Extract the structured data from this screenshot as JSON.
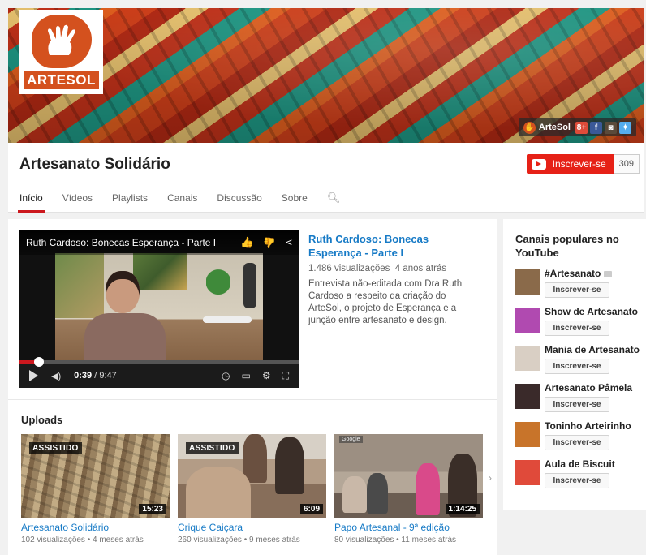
{
  "banner": {
    "logo_text": "ARTESOL",
    "link_name": "ArteSol",
    "social": [
      {
        "icon": "google-plus-icon",
        "glyph": "8+",
        "color": "#dd4b39"
      },
      {
        "icon": "facebook-icon",
        "glyph": "f",
        "color": "#3b5998"
      },
      {
        "icon": "instagram-icon",
        "glyph": "◙",
        "color": "#5a4a3a"
      },
      {
        "icon": "twitter-icon",
        "glyph": "✦",
        "color": "#55acee"
      }
    ]
  },
  "channel": {
    "title": "Artesanato Solidário",
    "subscribe_label": "Inscrever-se",
    "subscriber_count": "309",
    "tabs": [
      "Início",
      "Vídeos",
      "Playlists",
      "Canais",
      "Discussão",
      "Sobre"
    ],
    "active_tab": "Início"
  },
  "featured": {
    "player_title": "Ruth Cardoso: Bonecas Esperança - Parte I",
    "current_time": "0:39",
    "total_time": "/ 9:47",
    "progress": 0.07,
    "title": "Ruth Cardoso: Bonecas Esperança - Parte I",
    "views": "1.486 visualizações",
    "age": "4 anos atrás",
    "description": "Entrevista não-editada com Dra Ruth Cardoso a respeito da criação do ArteSol, o projeto de Esperança e a junção entre artesanato e design."
  },
  "uploads": {
    "title": "Uploads",
    "items": [
      {
        "title": "Artesanato Solidário",
        "meta": "102 visualizações • 4 meses atrás",
        "duration": "15:23",
        "badge": "ASSISTIDO"
      },
      {
        "title": "Crique Caiçara",
        "meta": "260 visualizações • 9 meses atrás",
        "duration": "6:09",
        "badge": "ASSISTIDO"
      },
      {
        "title": "Papo Artesanal - 9ª edição",
        "meta": "80 visualizações • 11 meses atrás",
        "duration": "1:14:25",
        "badge": "Google"
      }
    ]
  },
  "sidebar": {
    "title": "Canais populares no YouTube",
    "subscribe_label": "Inscrever-se",
    "channels": [
      {
        "name": "#Artesanato",
        "avatar_color": "#8a6a4a",
        "verified": true
      },
      {
        "name": "Show de Artesanato",
        "avatar_color": "#b04ab0",
        "verified": false
      },
      {
        "name": "Mania de Artesanato",
        "avatar_color": "#d9cfc4",
        "verified": false
      },
      {
        "name": "Artesanato Pâmela",
        "avatar_color": "#3a2a2a",
        "verified": false
      },
      {
        "name": "Toninho Arteirinho",
        "avatar_color": "#c8742a",
        "verified": false
      },
      {
        "name": "Aula de Biscuit",
        "avatar_color": "#e04a3a",
        "verified": false
      }
    ]
  }
}
